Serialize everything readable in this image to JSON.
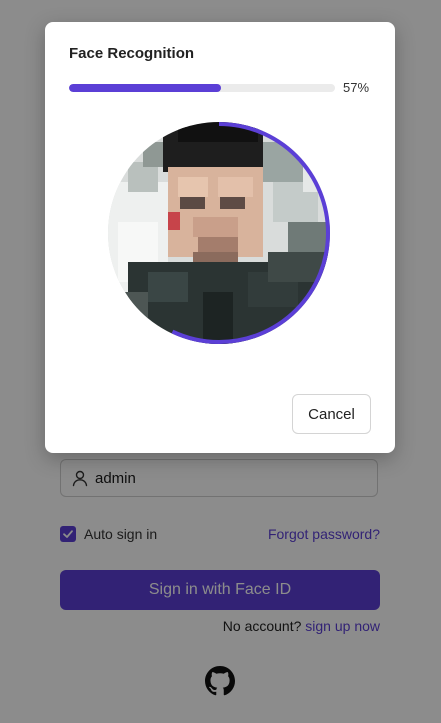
{
  "login": {
    "username_value": "admin",
    "auto_sign_in_label": "Auto sign in",
    "auto_sign_in_checked": true,
    "forgot_password_label": "Forgot password?",
    "signin_button_label": "Sign in with Face ID",
    "no_account_text": "No account?",
    "signup_link_label": "sign up now",
    "icons": {
      "username": "user-icon",
      "checkbox": "check-icon",
      "footer": "github-icon"
    }
  },
  "modal": {
    "title": "Face Recognition",
    "progress": 57,
    "progress_text": "57%",
    "cancel_label": "Cancel"
  },
  "colors": {
    "accent": "#5b3fd6",
    "overlay": "rgba(0,0,0,0.45)"
  }
}
